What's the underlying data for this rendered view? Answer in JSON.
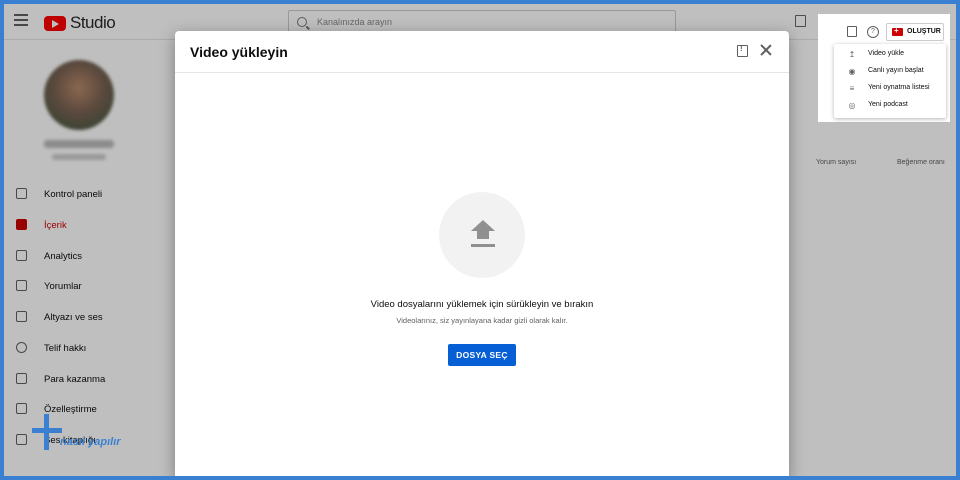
{
  "app": {
    "logo_text": "Studio",
    "search_placeholder": "Kanalınızda arayın"
  },
  "sidebar": {
    "items": [
      {
        "label": "Kontrol paneli"
      },
      {
        "label": "İçerik"
      },
      {
        "label": "Analytics"
      },
      {
        "label": "Yorumlar"
      },
      {
        "label": "Altyazı ve ses"
      },
      {
        "label": "Telif hakkı"
      },
      {
        "label": "Para kazanma"
      },
      {
        "label": "Özelleştirme"
      },
      {
        "label": "Ses kitaplığı"
      }
    ]
  },
  "background_columns": {
    "col1": "Yorum sayısı",
    "col2": "Beğenme oranı"
  },
  "modal": {
    "title": "Video yükleyin",
    "drop_title": "Video dosyalarını yüklemek için sürükleyin ve bırakın",
    "drop_subtitle": "Videolarınız, siz yayınlayana kadar gizli olarak kalır.",
    "select_button": "DOSYA SEÇ"
  },
  "create_menu": {
    "button_label": "OLUŞTUR",
    "help_glyph": "?",
    "items": [
      {
        "label": "Video yükle",
        "icon": "upload-icon"
      },
      {
        "label": "Canlı yayın başlat",
        "icon": "live-icon"
      },
      {
        "label": "Yeni oynatma listesi",
        "icon": "playlist-add-icon"
      },
      {
        "label": "Yeni podcast",
        "icon": "podcast-icon"
      }
    ]
  },
  "watermark": {
    "text": "nasıl yapılır"
  },
  "colors": {
    "accent_blue": "#065fd4",
    "brand_red": "#ff0000",
    "active_red": "#cc0000",
    "frame_blue": "#3b7fd0"
  }
}
